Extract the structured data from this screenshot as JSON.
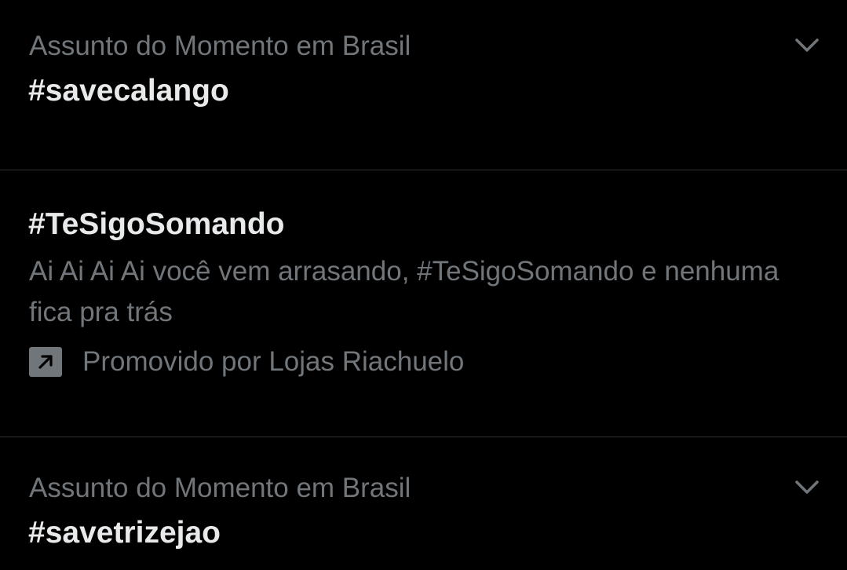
{
  "trends": [
    {
      "context": "Assunto do Momento em Brasil",
      "title": "#savecalango",
      "menu_icon": "chevron-down-icon"
    },
    {
      "title": "#TeSigoSomando",
      "description": "Ai Ai Ai Ai você vem arrasando, #TeSigoSomando e nenhuma fica pra trás",
      "promoted_icon": "promoted-arrow-icon",
      "promoted_text": "Promovido por Lojas Riachuelo"
    },
    {
      "context": "Assunto do Momento em Brasil",
      "title": "#savetrizejao",
      "menu_icon": "chevron-down-icon"
    }
  ],
  "colors": {
    "background": "#000000",
    "primary_text": "#e7e9ea",
    "secondary_text": "#71767b",
    "divider": "#2f3336"
  }
}
